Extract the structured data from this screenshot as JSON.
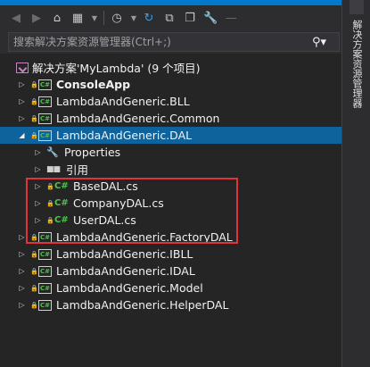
{
  "toolbar": {
    "icons": [
      "back-icon",
      "forward-icon",
      "home-icon",
      "switch-view-icon",
      "history-icon",
      "refresh-icon",
      "collapse-all-icon",
      "show-all-files-icon",
      "properties-icon",
      "preview-icon"
    ]
  },
  "search": {
    "placeholder": "搜索解决方案资源管理器(Ctrl+;)",
    "icon": "search-icon"
  },
  "side_tab": {
    "label": "解决方案资源管理器"
  },
  "tree": {
    "solution": "解决方案'MyLambda' (9 个项目)",
    "items": [
      {
        "label": "ConsoleApp",
        "bold": true
      },
      {
        "label": "LambdaAndGeneric.BLL"
      },
      {
        "label": "LambdaAndGeneric.Common"
      },
      {
        "label": "LambdaAndGeneric.DAL",
        "selected": true,
        "expanded": true
      },
      {
        "label": "Properties"
      },
      {
        "label": "引用"
      },
      {
        "label": "BaseDAL.cs"
      },
      {
        "label": "CompanyDAL.cs"
      },
      {
        "label": "UserDAL.cs"
      },
      {
        "label": "LambdaAndGeneric.FactoryDAL"
      },
      {
        "label": "LambdaAndGeneric.IBLL"
      },
      {
        "label": "LambdaAndGeneric.IDAL"
      },
      {
        "label": "LambdaAndGeneric.Model"
      },
      {
        "label": "LamdbaAndGeneric.HelperDAL"
      }
    ]
  },
  "colors": {
    "panel_bg": "#252526",
    "selection": "#0e639c",
    "highlight_box": "#e0343c",
    "csharp_green": "#4fc14f"
  }
}
